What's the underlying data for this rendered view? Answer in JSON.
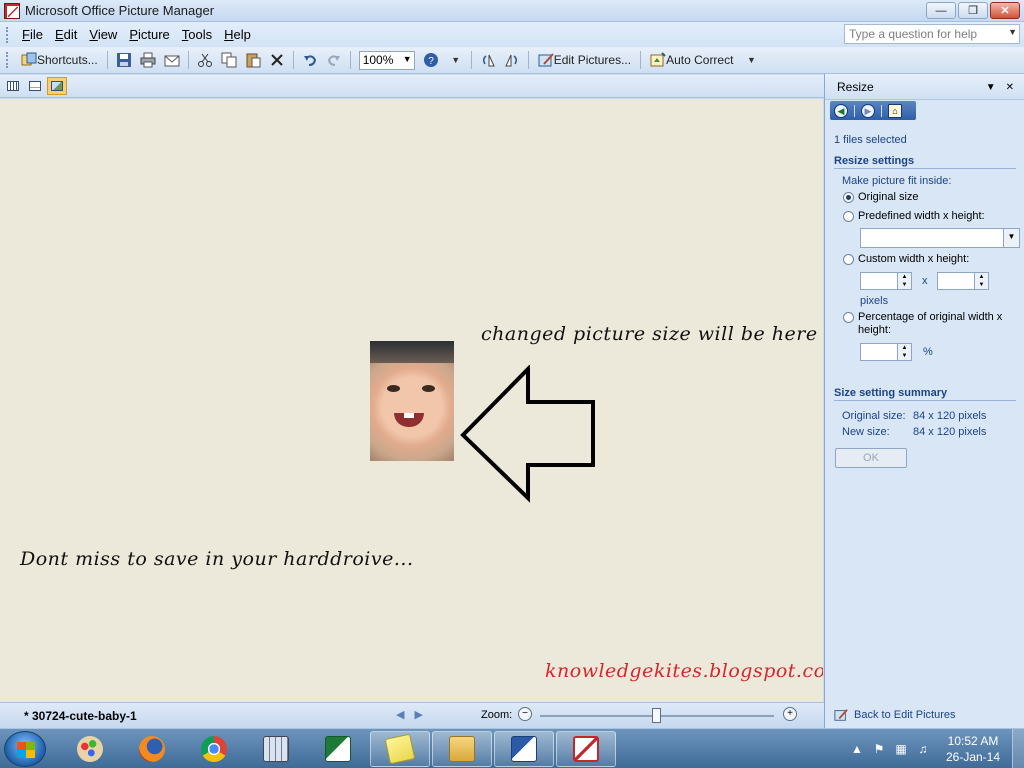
{
  "window": {
    "title": "Microsoft Office Picture Manager"
  },
  "menu": {
    "items": [
      "File",
      "Edit",
      "View",
      "Picture",
      "Tools",
      "Help"
    ],
    "help_placeholder": "Type a question for help"
  },
  "toolbar": {
    "shortcuts_label": "Shortcuts...",
    "zoom_value": "100%",
    "edit_pictures_label": "Edit Pictures...",
    "auto_correct_label": "Auto Correct"
  },
  "canvas": {
    "annotation_top": "changed picture size will be here",
    "annotation_bottom": "Dont miss to save in your harddroive...",
    "watermark": "knowledgekites.blogspot.com"
  },
  "status": {
    "file_name": "* 30724-cute-baby-1",
    "zoom_label": "Zoom:",
    "zoom_level": 0.5
  },
  "task_pane": {
    "title": "Resize",
    "files_selected": "1 files selected",
    "resize_settings_heading": "Resize settings",
    "fit_label": "Make picture fit inside:",
    "option_original": "Original size",
    "option_predefined": "Predefined width x height:",
    "option_custom": "Custom width x height:",
    "times_symbol": "x",
    "pixels_label": "pixels",
    "option_percentage": "Percentage of original width x height:",
    "percent_symbol": "%",
    "summary_heading": "Size setting summary",
    "original_size_label": "Original size:",
    "original_size_value": "84 x 120 pixels",
    "new_size_label": "New size:",
    "new_size_value": "84 x 120 pixels",
    "ok_label": "OK",
    "back_link": "Back to Edit Pictures"
  },
  "taskbar": {
    "time": "10:52 AM",
    "date": "26-Jan-14"
  },
  "colors": {
    "accent": "#1d4389",
    "watermark": "#d0282d",
    "canvas": "#ede9da"
  }
}
